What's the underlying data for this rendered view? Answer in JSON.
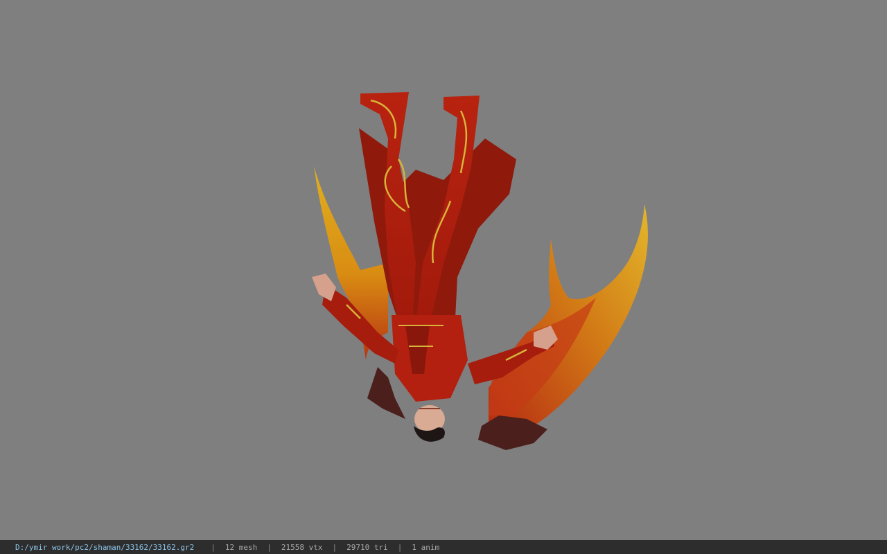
{
  "viewer": {
    "file_path": "D:/ymir work/pc2/shaman/33162/33162.gr2",
    "stats": {
      "mesh": "12 mesh",
      "vtx": "21558 vtx",
      "tri": "29710 tri",
      "anim": "1 anim"
    },
    "separator": "|",
    "background_color": "#7f7f7f",
    "statusbar_color": "#2d2d2d",
    "path_color": "#8cc3e8"
  }
}
